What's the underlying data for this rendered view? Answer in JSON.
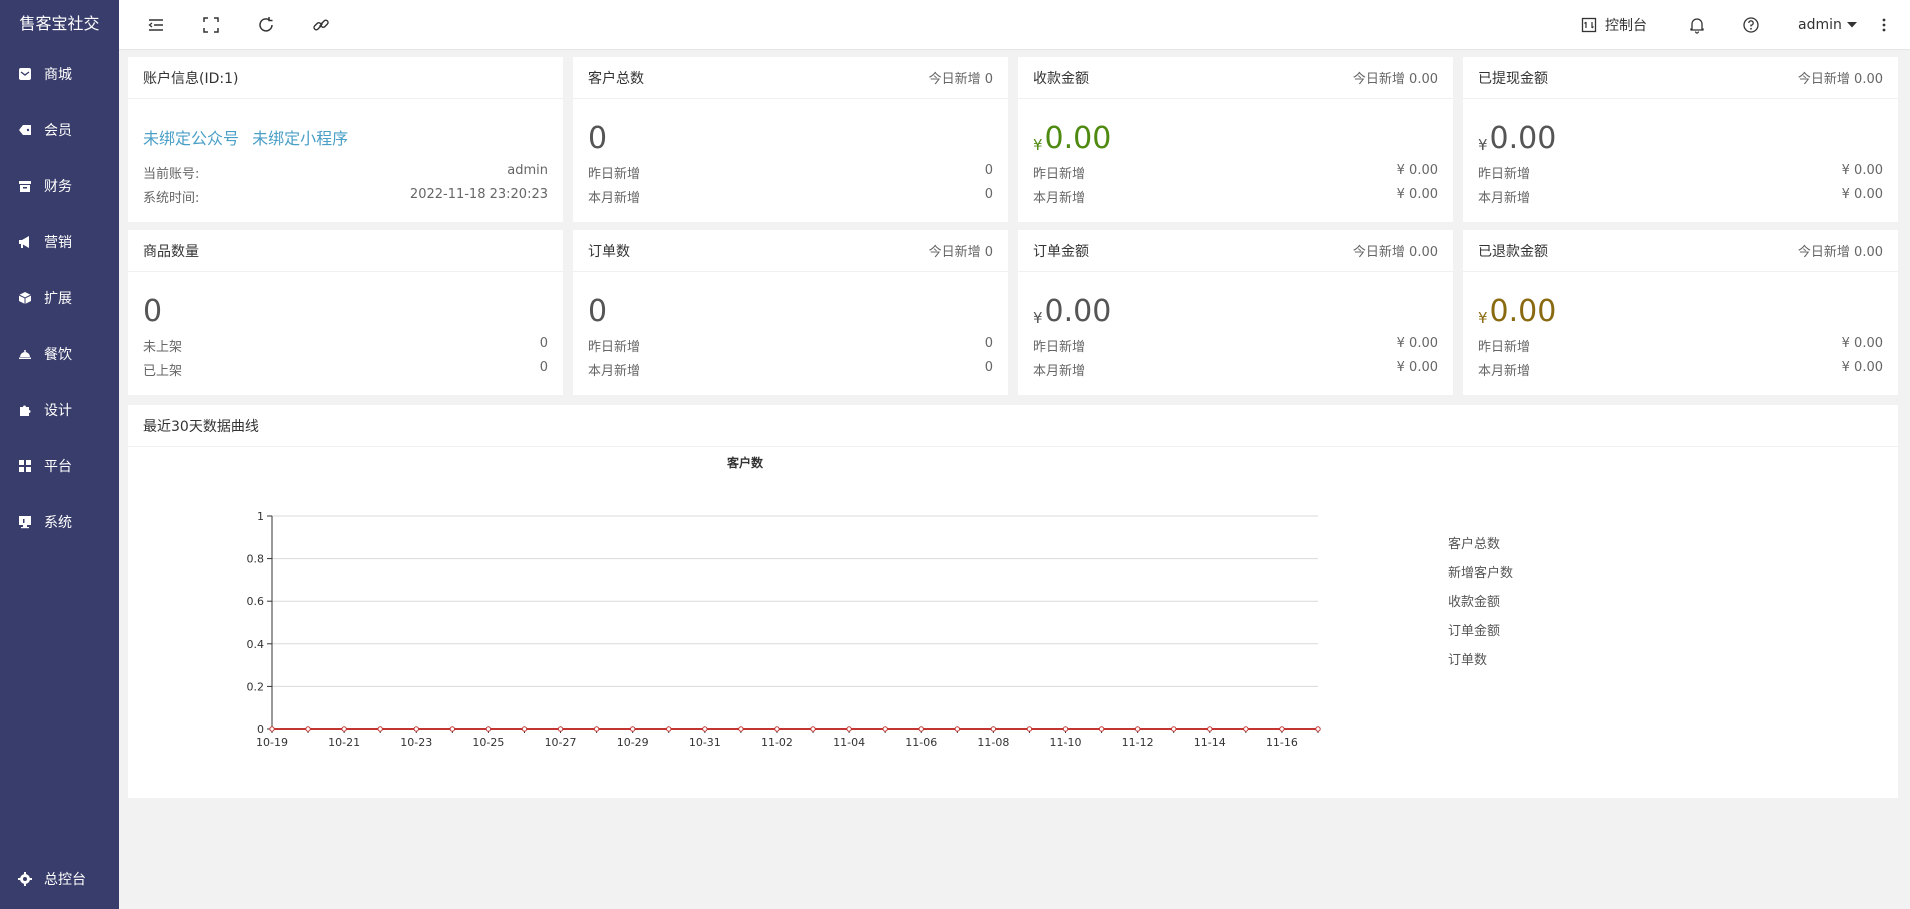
{
  "app": {
    "title": "售客宝社交"
  },
  "sidebar": {
    "items": [
      {
        "label": "商城",
        "icon": "mail-icon"
      },
      {
        "label": "会员",
        "icon": "tag-icon"
      },
      {
        "label": "财务",
        "icon": "archive-icon"
      },
      {
        "label": "营销",
        "icon": "megaphone-icon"
      },
      {
        "label": "扩展",
        "icon": "cube-icon"
      },
      {
        "label": "餐饮",
        "icon": "cloche-icon"
      },
      {
        "label": "设计",
        "icon": "puzzle-icon"
      },
      {
        "label": "平台",
        "icon": "grid-icon"
      },
      {
        "label": "系统",
        "icon": "monitor-icon"
      }
    ],
    "bottom": {
      "label": "总控台",
      "icon": "gear-icon"
    }
  },
  "header": {
    "console_label": "控制台",
    "user": "admin"
  },
  "cards": {
    "account": {
      "title": "账户信息(ID:1)",
      "link_wechat": "未绑定公众号",
      "link_mini": "未绑定小程序",
      "account_label": "当前账号:",
      "account_value": "admin",
      "time_label": "系统时间:",
      "time_value": "2022-11-18 23:20:23"
    },
    "customers": {
      "title": "客户总数",
      "today": "今日新增 0",
      "value": "0",
      "row1_label": "昨日新增",
      "row1_value": "0",
      "row2_label": "本月新增",
      "row2_value": "0"
    },
    "received": {
      "title": "收款金额",
      "today": "今日新增 0.00",
      "yen": "¥",
      "value": "0.00",
      "row1_label": "昨日新增",
      "row1_value": "¥ 0.00",
      "row2_label": "本月新增",
      "row2_value": "¥ 0.00"
    },
    "withdrawn": {
      "title": "已提现金额",
      "today": "今日新增 0.00",
      "yen": "¥",
      "value": "0.00",
      "row1_label": "昨日新增",
      "row1_value": "¥ 0.00",
      "row2_label": "本月新增",
      "row2_value": "¥ 0.00"
    },
    "products": {
      "title": "商品数量",
      "value": "0",
      "row1_label": "未上架",
      "row1_value": "0",
      "row2_label": "已上架",
      "row2_value": "0"
    },
    "orders": {
      "title": "订单数",
      "today": "今日新增 0",
      "value": "0",
      "row1_label": "昨日新增",
      "row1_value": "0",
      "row2_label": "本月新增",
      "row2_value": "0"
    },
    "order_amount": {
      "title": "订单金额",
      "today": "今日新增 0.00",
      "yen": "¥",
      "value": "0.00",
      "row1_label": "昨日新增",
      "row1_value": "¥ 0.00",
      "row2_label": "本月新增",
      "row2_value": "¥ 0.00"
    },
    "refunded": {
      "title": "已退款金额",
      "today": "今日新增 0.00",
      "yen": "¥",
      "value": "0.00",
      "row1_label": "昨日新增",
      "row1_value": "¥ 0.00",
      "row2_label": "本月新增",
      "row2_value": "¥ 0.00"
    }
  },
  "chart_section": {
    "title": "最近30天数据曲线"
  },
  "colors": {
    "sidebar_bg": "#393d6b",
    "link": "#4a9fc7",
    "green_amount": "#4f8a10",
    "gold_amount": "#8a6a10",
    "series_line": "#c23531"
  },
  "chart_data": {
    "type": "line",
    "title": "客户数",
    "x": [
      "10-19",
      "10-20",
      "10-21",
      "10-22",
      "10-23",
      "10-24",
      "10-25",
      "10-26",
      "10-27",
      "10-28",
      "10-29",
      "10-30",
      "10-31",
      "11-01",
      "11-02",
      "11-03",
      "11-04",
      "11-05",
      "11-06",
      "11-07",
      "11-08",
      "11-09",
      "11-10",
      "11-11",
      "11-12",
      "11-13",
      "11-14",
      "11-15",
      "11-16",
      "11-17"
    ],
    "x_tick_labels": [
      "10-19",
      "10-21",
      "10-23",
      "10-25",
      "10-27",
      "10-29",
      "10-31",
      "11-02",
      "11-04",
      "11-06",
      "11-08",
      "11-10",
      "11-12",
      "11-14",
      "11-16"
    ],
    "ylim": [
      0,
      1
    ],
    "y_ticks": [
      "0",
      "0.2",
      "0.4",
      "0.6",
      "0.8",
      "1"
    ],
    "legend": [
      "客户总数",
      "新增客户数",
      "收款金额",
      "订单金额",
      "订单数"
    ],
    "legend_position": "right",
    "grid": true,
    "series": [
      {
        "values": [
          0,
          0,
          0,
          0,
          0,
          0,
          0,
          0,
          0,
          0,
          0,
          0,
          0,
          0,
          0,
          0,
          0,
          0,
          0,
          0,
          0,
          0,
          0,
          0,
          0,
          0,
          0,
          0,
          0,
          0
        ]
      }
    ]
  }
}
